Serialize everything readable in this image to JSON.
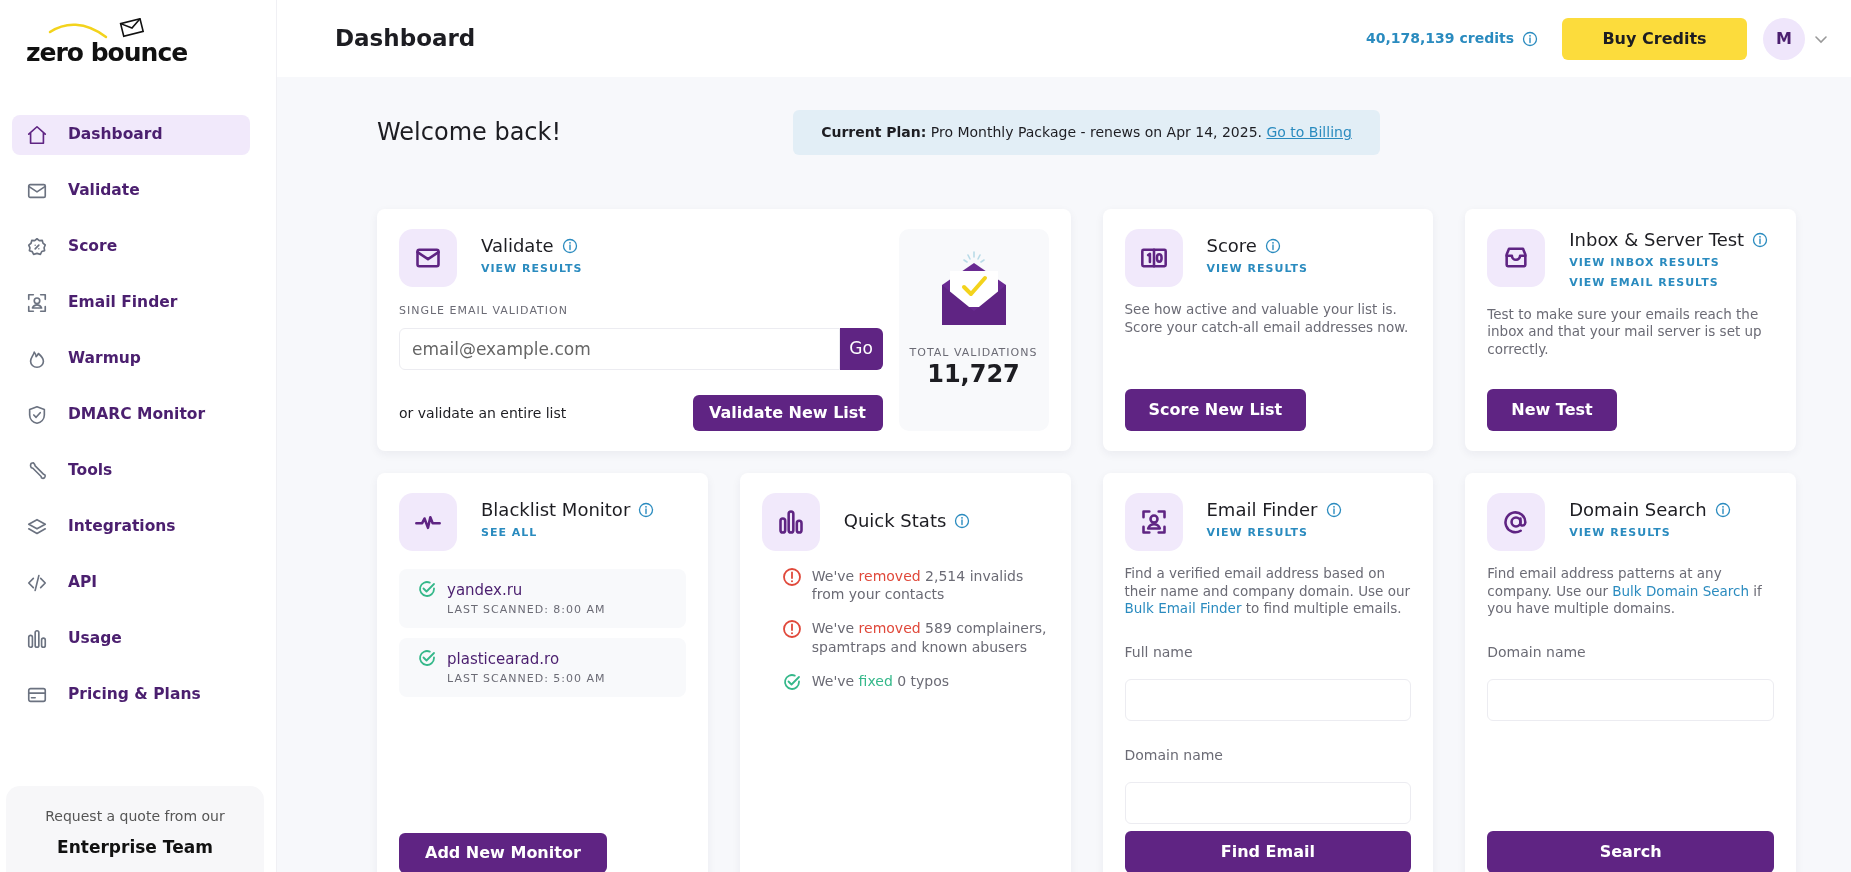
{
  "logo": {
    "text": "zero bounce"
  },
  "sidebar": {
    "items": [
      {
        "label": "Dashboard",
        "selected": true
      },
      {
        "label": "Validate",
        "selected": false
      },
      {
        "label": "Score",
        "selected": false
      },
      {
        "label": "Email Finder",
        "selected": false
      },
      {
        "label": "Warmup",
        "selected": false
      },
      {
        "label": "DMARC Monitor",
        "selected": false
      },
      {
        "label": "Tools",
        "selected": false
      },
      {
        "label": "Integrations",
        "selected": false
      },
      {
        "label": "API",
        "selected": false
      },
      {
        "label": "Usage",
        "selected": false
      },
      {
        "label": "Pricing & Plans",
        "selected": false
      }
    ],
    "enterprise": {
      "text": "Request a quote from our",
      "link": "Enterprise Team"
    }
  },
  "header": {
    "title": "Dashboard",
    "credits": "40,178,139 credits",
    "buy_button": "Buy Credits",
    "avatar": "M"
  },
  "welcome": "Welcome back!",
  "plan_banner": {
    "text": "**Current Plan:** Pro Monthly Package - renews on Apr 14, 2025.",
    "link": "Go to Billing"
  },
  "cards": [
    {
      "kind": "validate",
      "title": "Validate",
      "links": [
        "VIEW RESULTS"
      ],
      "field_label": "SINGLE EMAIL VALIDATION",
      "placeholder": "email@example.com",
      "go_button": "Go",
      "alt_text": "or validate an entire list",
      "button": "Validate New List",
      "stat_label": "TOTAL VALIDATIONS",
      "stat_value": "11,727"
    },
    {
      "kind": "action",
      "title": "Score",
      "links": [
        "VIEW RESULTS"
      ],
      "description": "See how active and valuable your list is. Score your catch-all email addresses now.",
      "button": "Score New List"
    },
    {
      "kind": "action",
      "title": "Inbox & Server Test",
      "links": [
        "VIEW INBOX RESULTS",
        "VIEW EMAIL RESULTS"
      ],
      "description": "Test to make sure your emails reach the inbox and that your mail server is set up correctly.",
      "button": "New Test"
    },
    {
      "kind": "blacklist",
      "title": "Blacklist Monitor",
      "links": [
        "SEE ALL"
      ],
      "monitors": [
        {
          "domain": "yandex.ru",
          "scanned": "LAST SCANNED: 8:00 AM"
        },
        {
          "domain": "plasticearad.ro",
          "scanned": "LAST SCANNED: 5:00 AM"
        }
      ],
      "button": "Add New Monitor"
    },
    {
      "kind": "stats",
      "title": "Quick Stats",
      "items": [
        {
          "kind": "error",
          "before": "We've ",
          "highlight": "removed",
          "after": " 2,514 invalids from your contacts"
        },
        {
          "kind": "error",
          "before": "We've ",
          "highlight": "removed",
          "after": " 589 complainers, spamtraps and known abusers"
        },
        {
          "kind": "ok",
          "before": "We've ",
          "highlight": "fixed",
          "after": " 0 typos"
        }
      ]
    },
    {
      "kind": "finder",
      "title": "Email Finder",
      "links": [
        "VIEW RESULTS"
      ],
      "description": {
        "before": "Find a verified email address based on their name and company domain. Use our ",
        "link": "Bulk Email Finder",
        "after": " to find multiple emails."
      },
      "fields": [
        "Full name",
        "Domain name"
      ],
      "button": "Find Email"
    },
    {
      "kind": "finder",
      "title": "Domain Search",
      "links": [
        "VIEW RESULTS"
      ],
      "description": {
        "before": "Find email address patterns at any company. Use our ",
        "link": "Bulk Domain Search",
        "after": " if you have multiple domains."
      },
      "fields": [
        "Domain name"
      ],
      "button": "Search"
    }
  ]
}
